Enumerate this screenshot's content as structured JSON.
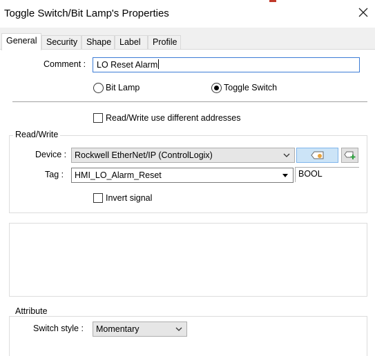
{
  "window": {
    "title": "Toggle Switch/Bit Lamp's Properties"
  },
  "tabs": [
    {
      "label": "General"
    },
    {
      "label": "Security"
    },
    {
      "label": "Shape"
    },
    {
      "label": "Label"
    },
    {
      "label": "Profile"
    }
  ],
  "general": {
    "comment_label": "Comment :",
    "comment_value": "LO Reset Alarm",
    "radio_options": [
      {
        "label": "Bit Lamp",
        "checked": false
      },
      {
        "label": "Toggle Switch",
        "checked": true
      }
    ],
    "rw_diff_label": "Read/Write use different addresses",
    "rw_diff_checked": false
  },
  "read_write": {
    "group_title": "Read/Write",
    "device_label": "Device :",
    "device_value": "Rockwell EtherNet/IP (ControlLogix)",
    "tag_label": "Tag :",
    "tag_value": "HMI_LO_Alarm_Reset",
    "tag_type": "BOOL",
    "invert_label": "Invert signal",
    "invert_checked": false
  },
  "attribute": {
    "group_title": "Attribute",
    "switch_style_label": "Switch style :",
    "switch_style_value": "Momentary"
  },
  "icons": {
    "close": "close-icon",
    "tag_browse": "tag-browse-icon",
    "tag_add": "tag-add-icon",
    "dropdown": "chevron-down-icon"
  },
  "colors": {
    "focus_border": "#3b7bd5",
    "pressed_button": "#cce4f7",
    "tag_icon_accent": "#e8a33d",
    "add_icon_accent": "#2e9e3e"
  }
}
